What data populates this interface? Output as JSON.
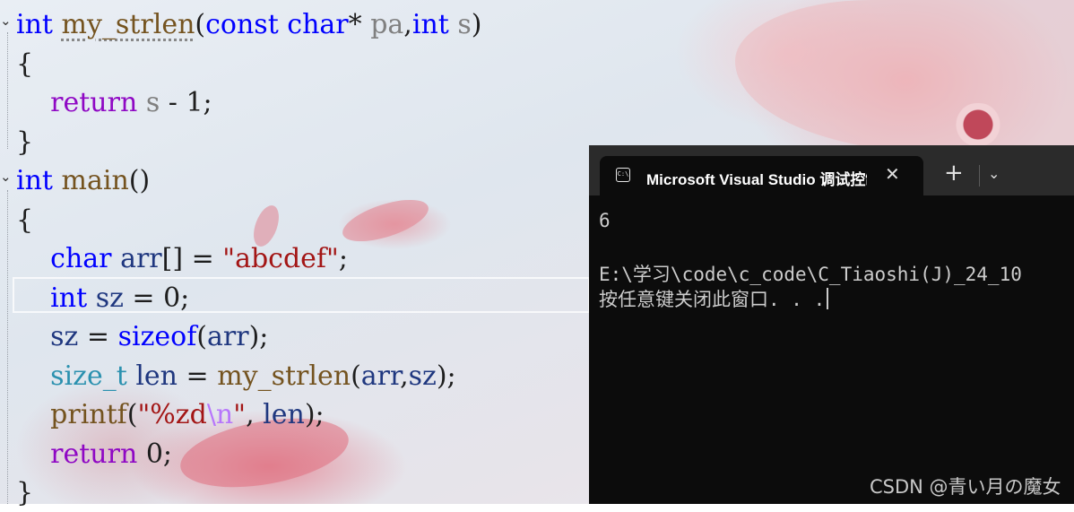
{
  "editor": {
    "lines": [
      {
        "segments": [
          {
            "t": "int",
            "c": "kw"
          },
          {
            "t": " ",
            "c": "nm"
          },
          {
            "t": "my_strlen",
            "c": "fn"
          },
          {
            "t": "(",
            "c": "nm"
          },
          {
            "t": "const",
            "c": "kw"
          },
          {
            "t": " ",
            "c": "nm"
          },
          {
            "t": "char",
            "c": "kw"
          },
          {
            "t": "* ",
            "c": "nm"
          },
          {
            "t": "pa",
            "c": "par"
          },
          {
            "t": ",",
            "c": "nm"
          },
          {
            "t": "int",
            "c": "kw"
          },
          {
            "t": " ",
            "c": "nm"
          },
          {
            "t": "s",
            "c": "par"
          },
          {
            "t": ")",
            "c": "nm"
          }
        ]
      },
      {
        "segments": [
          {
            "t": "{",
            "c": "nm"
          }
        ]
      },
      {
        "segments": [
          {
            "t": "    ",
            "c": "nm"
          },
          {
            "t": "return",
            "c": "ret"
          },
          {
            "t": " ",
            "c": "nm"
          },
          {
            "t": "s",
            "c": "par"
          },
          {
            "t": " - 1;",
            "c": "nm"
          }
        ]
      },
      {
        "segments": [
          {
            "t": "}",
            "c": "nm"
          }
        ]
      },
      {
        "segments": [
          {
            "t": "int",
            "c": "kw"
          },
          {
            "t": " ",
            "c": "nm"
          },
          {
            "t": "main",
            "c": "fn"
          },
          {
            "t": "()",
            "c": "nm"
          }
        ]
      },
      {
        "segments": [
          {
            "t": "{",
            "c": "nm"
          }
        ]
      },
      {
        "segments": [
          {
            "t": "    ",
            "c": "nm"
          },
          {
            "t": "char",
            "c": "kw"
          },
          {
            "t": " ",
            "c": "nm"
          },
          {
            "t": "arr",
            "c": "var"
          },
          {
            "t": "[] = ",
            "c": "nm"
          },
          {
            "t": "\"abcdef\"",
            "c": "str"
          },
          {
            "t": ";",
            "c": "nm"
          }
        ]
      },
      {
        "segments": [
          {
            "t": "    ",
            "c": "nm"
          },
          {
            "t": "int",
            "c": "kw"
          },
          {
            "t": " ",
            "c": "nm"
          },
          {
            "t": "sz",
            "c": "var"
          },
          {
            "t": " = 0;",
            "c": "nm"
          }
        ]
      },
      {
        "segments": [
          {
            "t": "    ",
            "c": "nm"
          },
          {
            "t": "sz",
            "c": "var"
          },
          {
            "t": " = ",
            "c": "nm"
          },
          {
            "t": "sizeof",
            "c": "kw"
          },
          {
            "t": "(",
            "c": "nm"
          },
          {
            "t": "arr",
            "c": "var"
          },
          {
            "t": ");",
            "c": "nm"
          }
        ]
      },
      {
        "segments": [
          {
            "t": "    ",
            "c": "nm"
          },
          {
            "t": "size_t",
            "c": "ty"
          },
          {
            "t": " ",
            "c": "nm"
          },
          {
            "t": "len",
            "c": "var"
          },
          {
            "t": " = ",
            "c": "nm"
          },
          {
            "t": "my_strlen",
            "c": "fn"
          },
          {
            "t": "(",
            "c": "nm"
          },
          {
            "t": "arr",
            "c": "var"
          },
          {
            "t": ",",
            "c": "nm"
          },
          {
            "t": "sz",
            "c": "var"
          },
          {
            "t": ");",
            "c": "nm"
          }
        ]
      },
      {
        "segments": [
          {
            "t": "    ",
            "c": "nm"
          },
          {
            "t": "printf",
            "c": "fn"
          },
          {
            "t": "(",
            "c": "nm"
          },
          {
            "t": "\"%zd",
            "c": "str"
          },
          {
            "t": "\\n",
            "c": "esc"
          },
          {
            "t": "\"",
            "c": "str"
          },
          {
            "t": ", ",
            "c": "nm"
          },
          {
            "t": "len",
            "c": "var"
          },
          {
            "t": ");",
            "c": "nm"
          }
        ]
      },
      {
        "segments": [
          {
            "t": "    ",
            "c": "nm"
          },
          {
            "t": "return",
            "c": "ret"
          },
          {
            "t": " 0;",
            "c": "nm"
          }
        ]
      },
      {
        "segments": [
          {
            "t": "}",
            "c": "nm"
          }
        ]
      }
    ],
    "fold_glyph": "⌄"
  },
  "terminal": {
    "tab_title": "Microsoft Visual Studio 调试控制台",
    "tab_icon": "terminal-icon",
    "close_glyph": "✕",
    "new_tab_glyph": "+",
    "dropdown_glyph": "⌄",
    "output_lines": [
      "6",
      "",
      "E:\\学习\\code\\c_code\\C_Tiaoshi(J)_24_10",
      "按任意键关闭此窗口. . ."
    ]
  },
  "watermark": "CSDN @青い月の魔女"
}
